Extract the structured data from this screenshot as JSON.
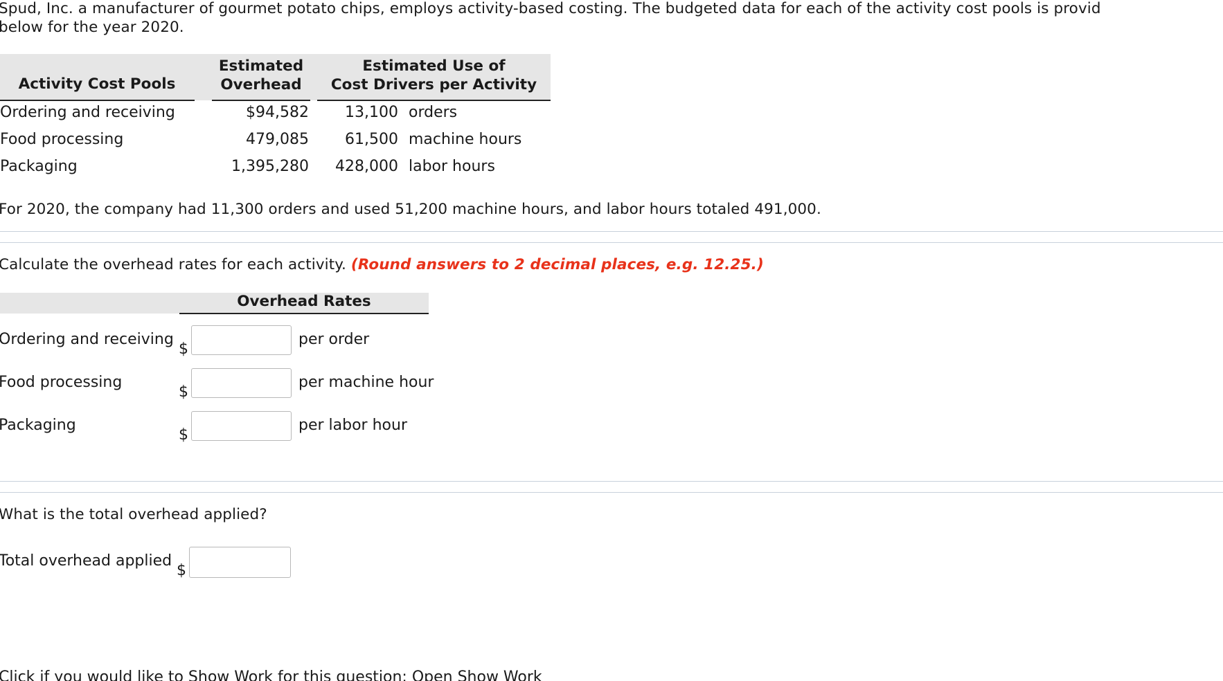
{
  "intro": {
    "line1": "Spud, Inc. a manufacturer of gourmet potato chips, employs activity-based costing. The budgeted data for each of the activity cost pools is provid",
    "line2": "below for the year 2020."
  },
  "budget_table": {
    "headers": {
      "pools": "Activity Cost Pools",
      "overhead_line1": "Estimated",
      "overhead_line2": "Overhead",
      "drivers_line1": "Estimated Use of",
      "drivers_line2": "Cost Drivers per Activity"
    },
    "rows": [
      {
        "pool": "Ordering and receiving",
        "overhead": "$94,582",
        "quantity": "13,100",
        "unit": "orders"
      },
      {
        "pool": "Food processing",
        "overhead": "479,085",
        "quantity": "61,500",
        "unit": "machine hours"
      },
      {
        "pool": "Packaging",
        "overhead": "1,395,280",
        "quantity": "428,000",
        "unit": "labor hours"
      }
    ]
  },
  "actuals_text": "For 2020, the company had 11,300 orders and used 51,200 machine hours, and labor hours totaled 491,000.",
  "question1": {
    "prompt": "Calculate the overhead rates for each activity.",
    "instruction": "(Round answers to 2 decimal places, e.g. 12.25.)",
    "table_header": "Overhead Rates",
    "currency": "$",
    "rows": [
      {
        "label": "Ordering and receiving",
        "value": "",
        "unit": "per order"
      },
      {
        "label": "Food processing",
        "value": "",
        "unit": "per machine hour"
      },
      {
        "label": "Packaging",
        "value": "",
        "unit": "per labor hour"
      }
    ]
  },
  "question2": {
    "prompt": "What is the total overhead applied?",
    "label": "Total overhead applied",
    "currency": "$",
    "value": ""
  },
  "footer_cut": "Click if you would like to Show Work for this question: Open Show Work"
}
